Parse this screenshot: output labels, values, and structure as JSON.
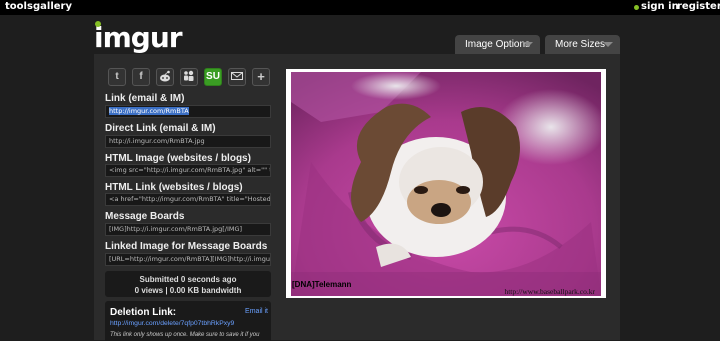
{
  "topbar": {
    "tools": "tools",
    "gallery": "gallery",
    "signin": "sign in",
    "register": "register"
  },
  "logo": "imgur",
  "tabs": {
    "image_options": "Image Options",
    "more_sizes": "More Sizes"
  },
  "share_icons": [
    "twitter-icon",
    "facebook-icon",
    "reddit-icon",
    "myspace-icon",
    "stumbleupon-icon",
    "email-icon",
    "plus-icon"
  ],
  "links": [
    {
      "label": "Link (email & IM)",
      "value": "http://imgur.com/RmBTA",
      "selected": true
    },
    {
      "label": "Direct Link (email & IM)",
      "value": "http://i.imgur.com/RmBTA.jpg"
    },
    {
      "label": "HTML Image (websites / blogs)",
      "value": "<img src=\"http://i.imgur.com/RmBTA.jpg\" alt=\"\" title=\"Hosted by imgur.com\" />"
    },
    {
      "label": "HTML Link (websites / blogs)",
      "value": "<a href=\"http://imgur.com/RmBTA\" title=\"Hosted by imgur.com\">"
    },
    {
      "label": "Message Boards",
      "value": "[IMG]http://i.imgur.com/RmBTA.jpg[/IMG]"
    },
    {
      "label": "Linked Image for Message Boards",
      "value": "[URL=http://imgur.com/RmBTA][IMG]http://i.imgur.com/RmBTA.jpg[/IMG][/URL]"
    }
  ],
  "stats": {
    "submitted": "Submitted 0 seconds ago",
    "views": "0 views | 0.00 KB bandwidth"
  },
  "deletion": {
    "title": "Deletion Link:",
    "email_it": "Email it",
    "url": "http://imgur.com/delete/7qfp07tbhRkPxy9",
    "note": "This link only shows up once. Make sure to save it if you"
  },
  "image": {
    "watermark_left": "[DNA]Telemann",
    "watermark_right": "http://www.baseballpark.co.kr"
  },
  "colors": {
    "accent_green": "#85bf25",
    "link_blue": "#6aa0ff",
    "selection_blue": "#3b6fc4"
  }
}
